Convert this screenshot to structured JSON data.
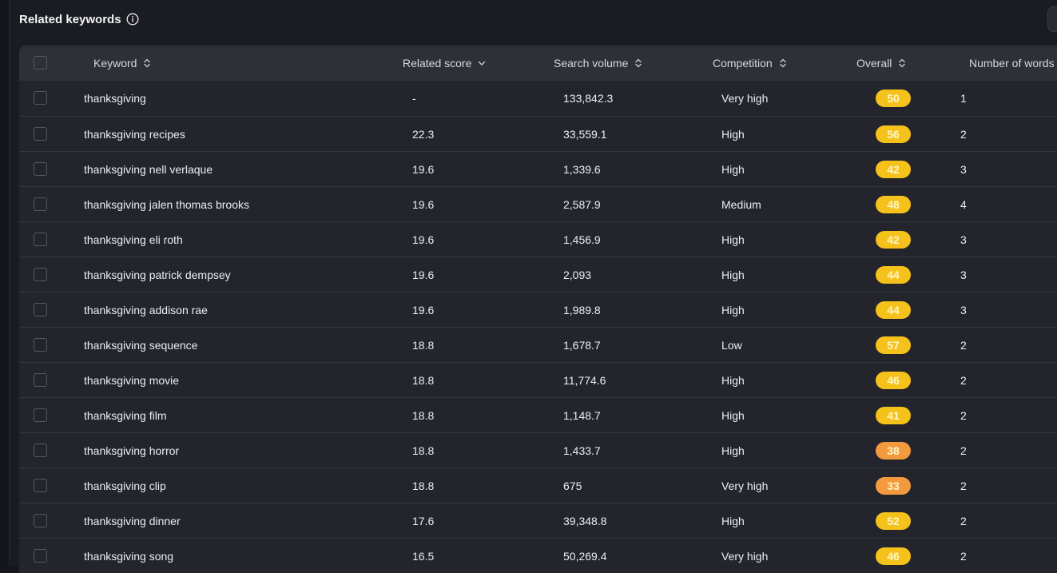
{
  "panel": {
    "title": "Related keywords",
    "info_icon": "info-circle-icon"
  },
  "table": {
    "columns": {
      "keyword": "Keyword",
      "related_score": "Related score",
      "search_volume": "Search volume",
      "competition": "Competition",
      "overall": "Overall",
      "number_of_words": "Number of words"
    },
    "sorted_by": "Related score",
    "rows": [
      {
        "keyword": "thanksgiving",
        "related_score": "-",
        "search_volume": "133,842.3",
        "competition": "Very high",
        "overall": "50",
        "overall_color": "#f5c21b",
        "words": "1"
      },
      {
        "keyword": "thanksgiving recipes",
        "related_score": "22.3",
        "search_volume": "33,559.1",
        "competition": "High",
        "overall": "56",
        "overall_color": "#f5c21b",
        "words": "2"
      },
      {
        "keyword": "thanksgiving nell verlaque",
        "related_score": "19.6",
        "search_volume": "1,339.6",
        "competition": "High",
        "overall": "42",
        "overall_color": "#f5c21b",
        "words": "3"
      },
      {
        "keyword": "thanksgiving jalen thomas brooks",
        "related_score": "19.6",
        "search_volume": "2,587.9",
        "competition": "Medium",
        "overall": "48",
        "overall_color": "#f5c21b",
        "words": "4"
      },
      {
        "keyword": "thanksgiving eli roth",
        "related_score": "19.6",
        "search_volume": "1,456.9",
        "competition": "High",
        "overall": "42",
        "overall_color": "#f5c21b",
        "words": "3"
      },
      {
        "keyword": "thanksgiving patrick dempsey",
        "related_score": "19.6",
        "search_volume": "2,093",
        "competition": "High",
        "overall": "44",
        "overall_color": "#f5c21b",
        "words": "3"
      },
      {
        "keyword": "thanksgiving addison rae",
        "related_score": "19.6",
        "search_volume": "1,989.8",
        "competition": "High",
        "overall": "44",
        "overall_color": "#f5c21b",
        "words": "3"
      },
      {
        "keyword": "thanksgiving sequence",
        "related_score": "18.8",
        "search_volume": "1,678.7",
        "competition": "Low",
        "overall": "57",
        "overall_color": "#f5c21b",
        "words": "2"
      },
      {
        "keyword": "thanksgiving movie",
        "related_score": "18.8",
        "search_volume": "11,774.6",
        "competition": "High",
        "overall": "46",
        "overall_color": "#f5c21b",
        "words": "2"
      },
      {
        "keyword": "thanksgiving film",
        "related_score": "18.8",
        "search_volume": "1,148.7",
        "competition": "High",
        "overall": "41",
        "overall_color": "#f5c21b",
        "words": "2"
      },
      {
        "keyword": "thanksgiving horror",
        "related_score": "18.8",
        "search_volume": "1,433.7",
        "competition": "High",
        "overall": "38",
        "overall_color": "#f39a3f",
        "words": "2"
      },
      {
        "keyword": "thanksgiving clip",
        "related_score": "18.8",
        "search_volume": "675",
        "competition": "Very high",
        "overall": "33",
        "overall_color": "#f39a3f",
        "words": "2"
      },
      {
        "keyword": "thanksgiving dinner",
        "related_score": "17.6",
        "search_volume": "39,348.8",
        "competition": "High",
        "overall": "52",
        "overall_color": "#f5c21b",
        "words": "2"
      },
      {
        "keyword": "thanksgiving song",
        "related_score": "16.5",
        "search_volume": "50,269.4",
        "competition": "Very high",
        "overall": "46",
        "overall_color": "#f5c21b",
        "words": "2"
      }
    ]
  }
}
